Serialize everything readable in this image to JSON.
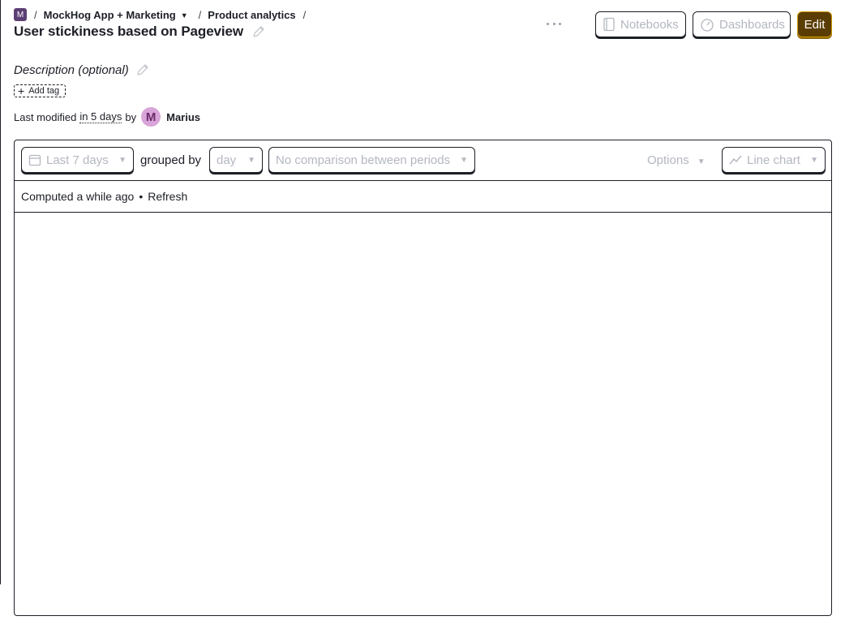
{
  "breadcrumb": {
    "org_initial": "M",
    "project": "MockHog App + Marketing",
    "section": "Product analytics"
  },
  "insight": {
    "title": "User stickiness based on Pageview",
    "description_placeholder": "Description (optional)",
    "add_tag_label": "Add tag",
    "last_modified_prefix": "Last modified",
    "last_modified_when": "in 5 days",
    "by_label": "by",
    "author_initial": "M",
    "author_name": "Marius"
  },
  "header_actions": {
    "notebooks_label": "Notebooks",
    "dashboards_label": "Dashboards",
    "edit_label": "Edit"
  },
  "toolbar": {
    "date_range": "Last 7 days",
    "grouped_by_label": "grouped by",
    "interval": "day",
    "comparison": "No comparison between periods",
    "options_label": "Options",
    "display_type": "Line chart"
  },
  "status": {
    "computed": "Computed a while ago",
    "separator": "•",
    "refresh_label": "Refresh"
  },
  "colors": {
    "accent_edit_bg": "#5a3d02",
    "accent_edit_border": "#d19a00",
    "org_badge": "#5b3f73",
    "avatar_bg": "#d9a4d8"
  }
}
